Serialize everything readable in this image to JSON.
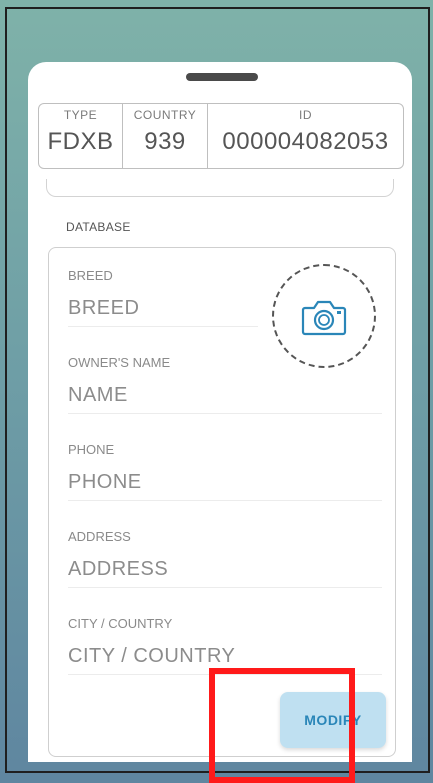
{
  "id_strip": {
    "type_label": "TYPE",
    "type_value": "FDXB",
    "country_label": "COUNTRY",
    "country_value": "939",
    "id_label": "ID",
    "id_value": "000004082053"
  },
  "database": {
    "section_label": "DATABASE",
    "fields": {
      "breed": {
        "label": "BREED",
        "value": "BREED"
      },
      "owner": {
        "label": "OWNER'S NAME",
        "value": "NAME"
      },
      "phone": {
        "label": "PHONE",
        "value": "PHONE"
      },
      "address": {
        "label": "ADDRESS",
        "value": "ADDRESS"
      },
      "city_country": {
        "label": "CITY / COUNTRY",
        "value": "CITY / COUNTRY"
      }
    },
    "photo_icon": "camera-icon"
  },
  "actions": {
    "modify_label": "MODIFY"
  },
  "colors": {
    "accent": "#2a86b8",
    "button_bg": "#bfe0f1",
    "highlight": "#ff1a1a"
  }
}
